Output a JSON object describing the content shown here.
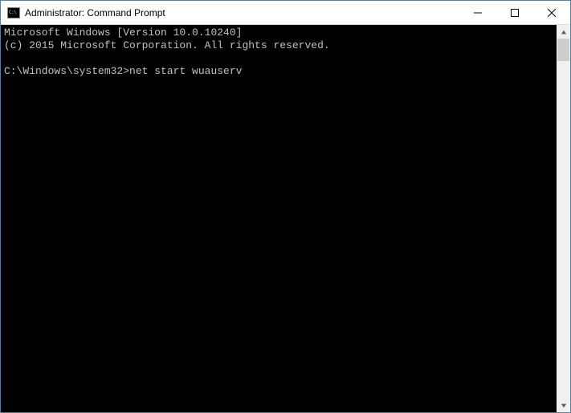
{
  "window": {
    "title": "Administrator: Command Prompt",
    "icon_label": "C:\\"
  },
  "terminal": {
    "line1": "Microsoft Windows [Version 10.0.10240]",
    "line2": "(c) 2015 Microsoft Corporation. All rights reserved.",
    "prompt": "C:\\Windows\\system32>",
    "command": "net start wuauserv"
  }
}
